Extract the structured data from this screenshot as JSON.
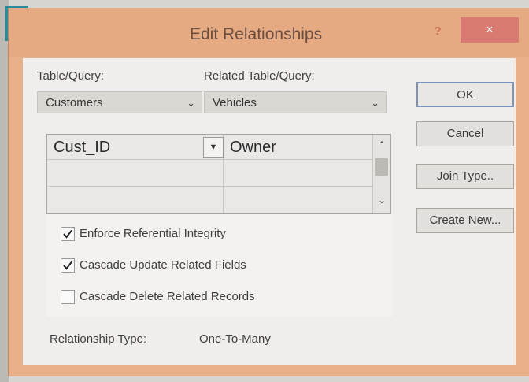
{
  "dialog": {
    "title": "Edit Relationships",
    "help_glyph": "?",
    "close_glyph": "×"
  },
  "left_pane": {
    "table_label": "Table/Query:",
    "table_value": "Customers",
    "related_label": "Related Table/Query:",
    "related_value": "Vehicles"
  },
  "grid": {
    "rows": [
      {
        "left": "Cust_ID",
        "right": "Owner"
      },
      {
        "left": "",
        "right": ""
      },
      {
        "left": "",
        "right": ""
      }
    ]
  },
  "buttons": {
    "ok": "OK",
    "cancel": "Cancel",
    "join_type": "Join Type..",
    "create_new": "Create New..."
  },
  "options": {
    "enforce": {
      "label": "Enforce Referential Integrity",
      "checked": true
    },
    "cascade_update": {
      "label": "Cascade Update Related Fields",
      "checked": true
    },
    "cascade_delete": {
      "label": "Cascade Delete Related Records",
      "checked": false
    }
  },
  "relationship": {
    "label": "Relationship Type:",
    "value": "One-To-Many"
  },
  "colors": {
    "title_bar": "#e6aa82",
    "close_button": "#d97b73",
    "client_bg": "#efeeec"
  }
}
